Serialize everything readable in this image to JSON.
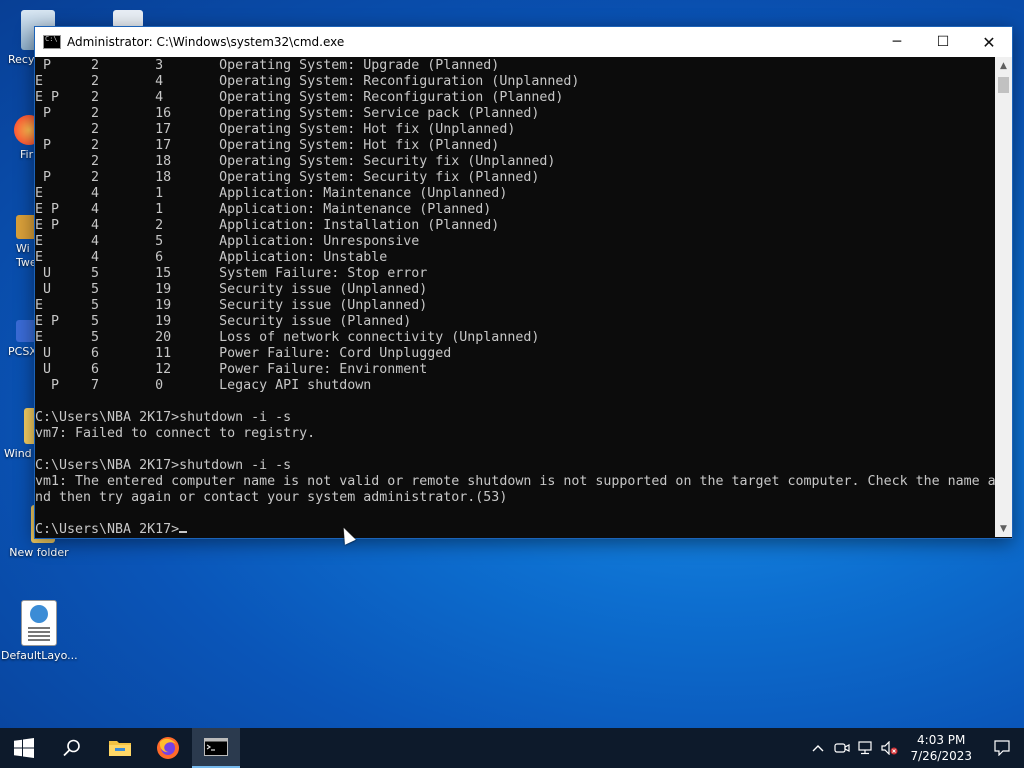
{
  "desktop": {
    "icons": [
      {
        "label": "Recy"
      },
      {
        "label": ""
      },
      {
        "label": "Fir"
      },
      {
        "label": "Wi\nTwe"
      },
      {
        "label": "PCSX"
      },
      {
        "label": "Wind"
      },
      {
        "label": "New folder"
      },
      {
        "label": "DefaultLayo..."
      }
    ]
  },
  "window": {
    "title": "Administrator: C:\\Windows\\system32\\cmd.exe",
    "controls": {
      "minimize": "─",
      "maximize": "☐",
      "close": "✕"
    },
    "console_lines": [
      " P     2       3       Operating System: Upgrade (Planned)",
      "E      2       4       Operating System: Reconfiguration (Unplanned)",
      "E P    2       4       Operating System: Reconfiguration (Planned)",
      " P     2       16      Operating System: Service pack (Planned)",
      "       2       17      Operating System: Hot fix (Unplanned)",
      " P     2       17      Operating System: Hot fix (Planned)",
      "       2       18      Operating System: Security fix (Unplanned)",
      " P     2       18      Operating System: Security fix (Planned)",
      "E      4       1       Application: Maintenance (Unplanned)",
      "E P    4       1       Application: Maintenance (Planned)",
      "E P    4       2       Application: Installation (Planned)",
      "E      4       5       Application: Unresponsive",
      "E      4       6       Application: Unstable",
      " U     5       15      System Failure: Stop error",
      " U     5       19      Security issue (Unplanned)",
      "E      5       19      Security issue (Unplanned)",
      "E P    5       19      Security issue (Planned)",
      "E      5       20      Loss of network connectivity (Unplanned)",
      " U     6       11      Power Failure: Cord Unplugged",
      " U     6       12      Power Failure: Environment",
      "  P    7       0       Legacy API shutdown",
      "",
      "C:\\Users\\NBA 2K17>shutdown -i -s",
      "vm7: Failed to connect to registry.",
      "",
      "C:\\Users\\NBA 2K17>shutdown -i -s",
      "vm1: The entered computer name is not valid or remote shutdown is not supported on the target computer. Check the name a",
      "nd then try again or contact your system administrator.(53)",
      ""
    ],
    "prompt": "C:\\Users\\NBA 2K17>"
  },
  "taskbar": {
    "start_icon": "windows-logo-icon",
    "items": [
      "search-icon",
      "file-explorer-icon",
      "firefox-icon",
      "cmd-icon"
    ],
    "tray_icons": [
      "chevron-up-icon",
      "meet-now-icon",
      "network-icon",
      "volume-muted-icon"
    ],
    "time": "4:03 PM",
    "date": "7/26/2023"
  }
}
